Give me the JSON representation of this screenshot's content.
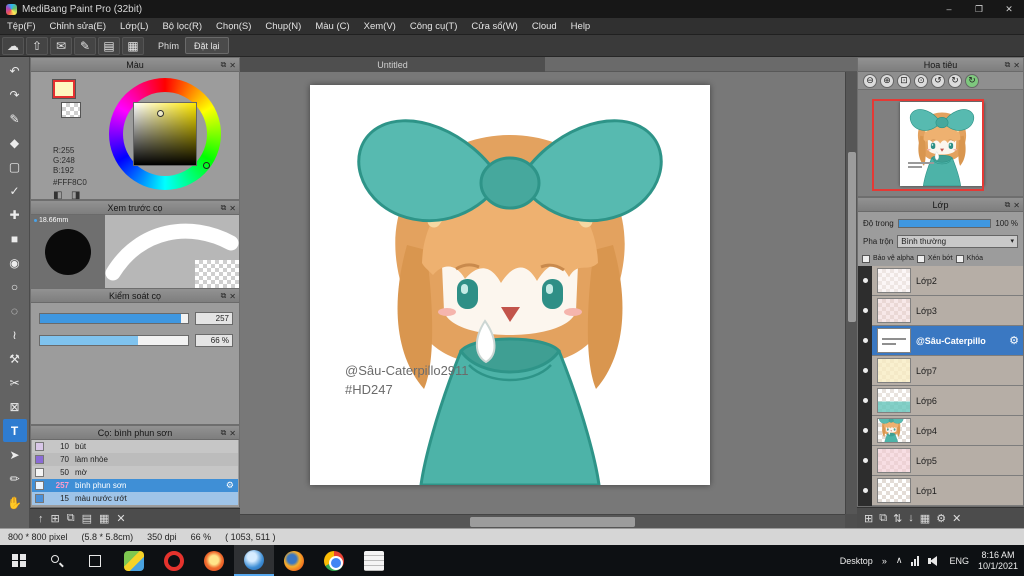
{
  "icons": {
    "popout": "⧉",
    "close": "✕",
    "gear": "⚙",
    "min": "–",
    "max": "❐",
    "x": "✕",
    "chev_down": "▾",
    "caret": "∧",
    "arrows": "»"
  },
  "window": {
    "title": "MediBang Paint Pro (32bit)"
  },
  "menu": {
    "items": [
      "Tệp(F)",
      "Chỉnh sửa(E)",
      "Lớp(L)",
      "Bộ lọc(R)",
      "Chọn(S)",
      "Chụp(N)",
      "Màu (C)",
      "Xem(V)",
      "Công cụ(T)",
      "Cửa sổ(W)",
      "Cloud",
      "Help"
    ]
  },
  "topbar": {
    "icons": [
      {
        "name": "cloud",
        "glyph": "☁"
      },
      {
        "name": "upload",
        "glyph": "⇧"
      },
      {
        "name": "comment",
        "glyph": "✉"
      },
      {
        "name": "brush-settings",
        "glyph": "✎"
      },
      {
        "name": "panels",
        "glyph": "▤"
      },
      {
        "name": "grid",
        "glyph": "▦"
      }
    ],
    "phim": "Phím",
    "reset": "Đặt lại"
  },
  "tools": [
    {
      "name": "undo",
      "glyph": "↶"
    },
    {
      "name": "redo",
      "glyph": "↷"
    },
    {
      "name": "brush",
      "glyph": "✎"
    },
    {
      "name": "eraser",
      "glyph": "◆"
    },
    {
      "name": "select-rect",
      "glyph": "▢"
    },
    {
      "name": "select-pen",
      "glyph": "✓"
    },
    {
      "name": "move",
      "glyph": "✚"
    },
    {
      "name": "shape-rect",
      "glyph": "■"
    },
    {
      "name": "bucket",
      "glyph": "◉"
    },
    {
      "name": "ellipse",
      "glyph": "○"
    },
    {
      "name": "select-dotted",
      "glyph": "◌"
    },
    {
      "name": "lasso",
      "glyph": "≀"
    },
    {
      "name": "operation",
      "glyph": "⚒"
    },
    {
      "name": "divide",
      "glyph": "✂"
    },
    {
      "name": "stamp",
      "glyph": "⊠"
    },
    {
      "name": "text",
      "glyph": "T"
    },
    {
      "name": "pointer",
      "glyph": "➤"
    },
    {
      "name": "pencil",
      "glyph": "✏"
    },
    {
      "name": "hand",
      "glyph": "✋"
    }
  ],
  "color_panel": {
    "title": "Màu",
    "r": "R:255",
    "g": "G:248",
    "b": "B:192",
    "hex": "#FFF8C0",
    "accent": "#FFF8C0"
  },
  "brush_preview": {
    "title": "Xem trước cọ",
    "size": "18.66mm"
  },
  "brush_control": {
    "title": "Kiểm soát cọ",
    "size_value": "257",
    "opacity_value": "66 %"
  },
  "brush_list": {
    "title": "Cọ: bình phun sơn",
    "items": [
      {
        "size": "10",
        "name": "bút",
        "swatch": "#d9c7e8"
      },
      {
        "size": "70",
        "name": "làm nhòe",
        "swatch": "#8a6bd6"
      },
      {
        "size": "50",
        "name": "mờ",
        "swatch": "#f5f5f5"
      },
      {
        "size": "257",
        "name": "bình phun sơn",
        "swatch": "#e8f4ff",
        "selected": true
      },
      {
        "size": "15",
        "name": "màu nước ướt",
        "swatch": "#4a90d9"
      }
    ],
    "footer_icons": [
      {
        "name": "move-up",
        "glyph": "↑"
      },
      {
        "name": "new-brush",
        "glyph": "⊞"
      },
      {
        "name": "duplicate-brush",
        "glyph": "⧉"
      },
      {
        "name": "brush-menu",
        "glyph": "▤"
      },
      {
        "name": "brush-folder",
        "glyph": "▦"
      },
      {
        "name": "delete-brush",
        "glyph": "✕"
      }
    ]
  },
  "canvas": {
    "tab": "Untitled",
    "watermark1": "@Sâu-Caterpillo2911",
    "watermark2": "#HD247"
  },
  "navigator": {
    "title": "Hoa tiêu",
    "icons": [
      {
        "name": "zoom-out",
        "glyph": "⊖"
      },
      {
        "name": "zoom-in",
        "glyph": "⊕"
      },
      {
        "name": "zoom-fit",
        "glyph": "⊡"
      },
      {
        "name": "zoom-100",
        "glyph": "⊙"
      },
      {
        "name": "rotate-left",
        "glyph": "↺"
      },
      {
        "name": "rotate-right",
        "glyph": "↻"
      },
      {
        "name": "reset-view",
        "glyph": "↻"
      }
    ]
  },
  "layers": {
    "title": "Lớp",
    "opacity_label": "Độ trong",
    "opacity_value": "100 %",
    "blend_label": "Pha trộn",
    "blend_value": "Bình thường",
    "check1": "Bảo vệ alpha",
    "check2": "Xén bớt",
    "check3": "Khóa",
    "items": [
      {
        "name": "Lớp2"
      },
      {
        "name": "Lớp3"
      },
      {
        "name": "@Sâu-Caterpillo",
        "selected": true
      },
      {
        "name": "Lớp7"
      },
      {
        "name": "Lớp6"
      },
      {
        "name": "Lớp4"
      },
      {
        "name": "Lớp5"
      },
      {
        "name": "Lớp1"
      }
    ],
    "footer_icons": [
      {
        "name": "new-layer",
        "glyph": "⊞"
      },
      {
        "name": "duplicate-layer",
        "glyph": "⧉"
      },
      {
        "name": "layer-order",
        "glyph": "⇅"
      },
      {
        "name": "merge-down",
        "glyph": "↓"
      },
      {
        "name": "layer-folder",
        "glyph": "▦"
      },
      {
        "name": "layer-settings",
        "glyph": "⚙"
      },
      {
        "name": "delete-layer",
        "glyph": "✕"
      }
    ]
  },
  "status": {
    "segments": [
      "800 * 800 pixel",
      "(5.8 * 5.8cm)",
      "350 dpi",
      "66 %",
      "( 1053, 511 )"
    ]
  },
  "taskbar": {
    "desktop": "Desktop",
    "lang": "ENG",
    "time": "8:16 AM",
    "date": "10/1/2021"
  }
}
